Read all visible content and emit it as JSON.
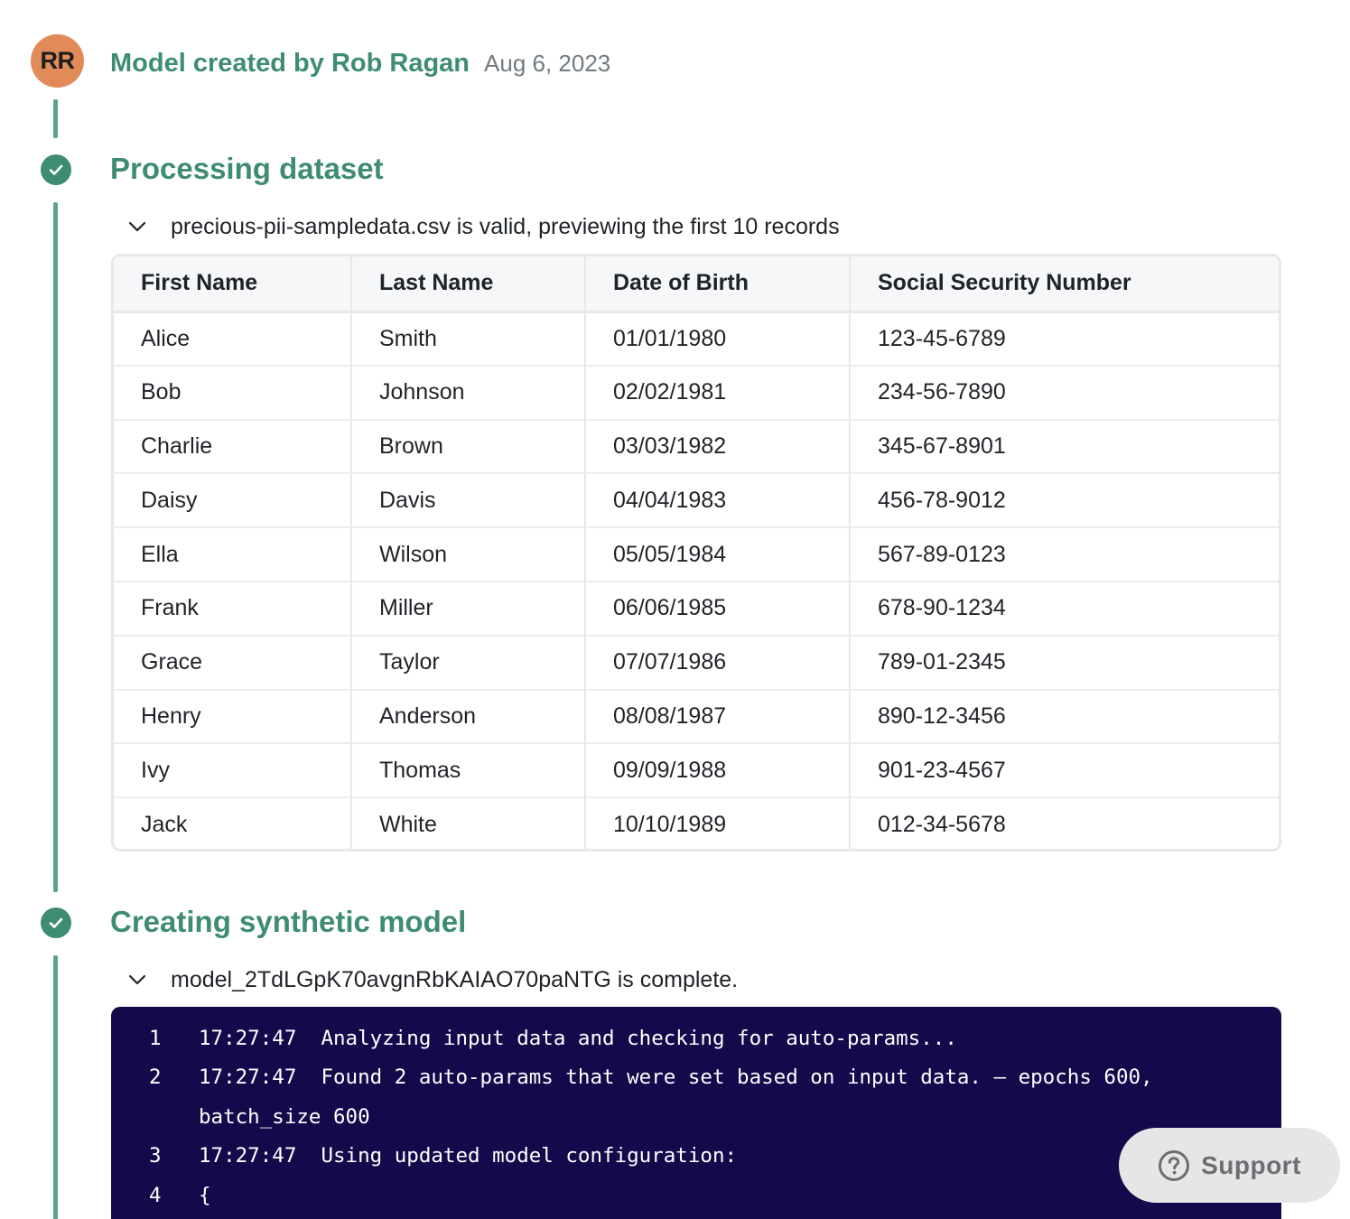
{
  "header": {
    "avatar_initials": "RR",
    "title": "Model created by Rob Ragan",
    "date": "Aug 6, 2023"
  },
  "colors": {
    "accent": "#3f8c75",
    "timeline": "#5ea08e",
    "avatar": "#e08b58",
    "code_bg": "#120a4b"
  },
  "steps": [
    {
      "title": "Processing dataset",
      "status_icon": "check-circle-icon",
      "summary": "precious-pii-sampledata.csv is valid, previewing the first 10 records"
    },
    {
      "title": "Creating synthetic model",
      "status_icon": "check-circle-icon",
      "summary": "model_2TdLGpK70avgnRbKAIAO70paNTG is complete."
    }
  ],
  "table": {
    "columns": [
      "First Name",
      "Last Name",
      "Date of Birth",
      "Social Security Number"
    ],
    "rows": [
      [
        "Alice",
        "Smith",
        "01/01/1980",
        "123-45-6789"
      ],
      [
        "Bob",
        "Johnson",
        "02/02/1981",
        "234-56-7890"
      ],
      [
        "Charlie",
        "Brown",
        "03/03/1982",
        "345-67-8901"
      ],
      [
        "Daisy",
        "Davis",
        "04/04/1983",
        "456-78-9012"
      ],
      [
        "Ella",
        "Wilson",
        "05/05/1984",
        "567-89-0123"
      ],
      [
        "Frank",
        "Miller",
        "06/06/1985",
        "678-90-1234"
      ],
      [
        "Grace",
        "Taylor",
        "07/07/1986",
        "789-01-2345"
      ],
      [
        "Henry",
        "Anderson",
        "08/08/1987",
        "890-12-3456"
      ],
      [
        "Ivy",
        "Thomas",
        "09/09/1988",
        "901-23-4567"
      ],
      [
        "Jack",
        "White",
        "10/10/1989",
        "012-34-5678"
      ]
    ]
  },
  "log": {
    "lines": [
      {
        "num": "1",
        "text": "17:27:47  Analyzing input data and checking for auto-params..."
      },
      {
        "num": "2",
        "text": "17:27:47  Found 2 auto-params that were set based on input data. – epochs 600,"
      },
      {
        "num": "",
        "text": "batch_size 600"
      },
      {
        "num": "3",
        "text": "17:27:47  Using updated model configuration:"
      },
      {
        "num": "4",
        "text": "{"
      }
    ]
  },
  "support": {
    "label": "Support",
    "icon": "help-circle-icon"
  }
}
